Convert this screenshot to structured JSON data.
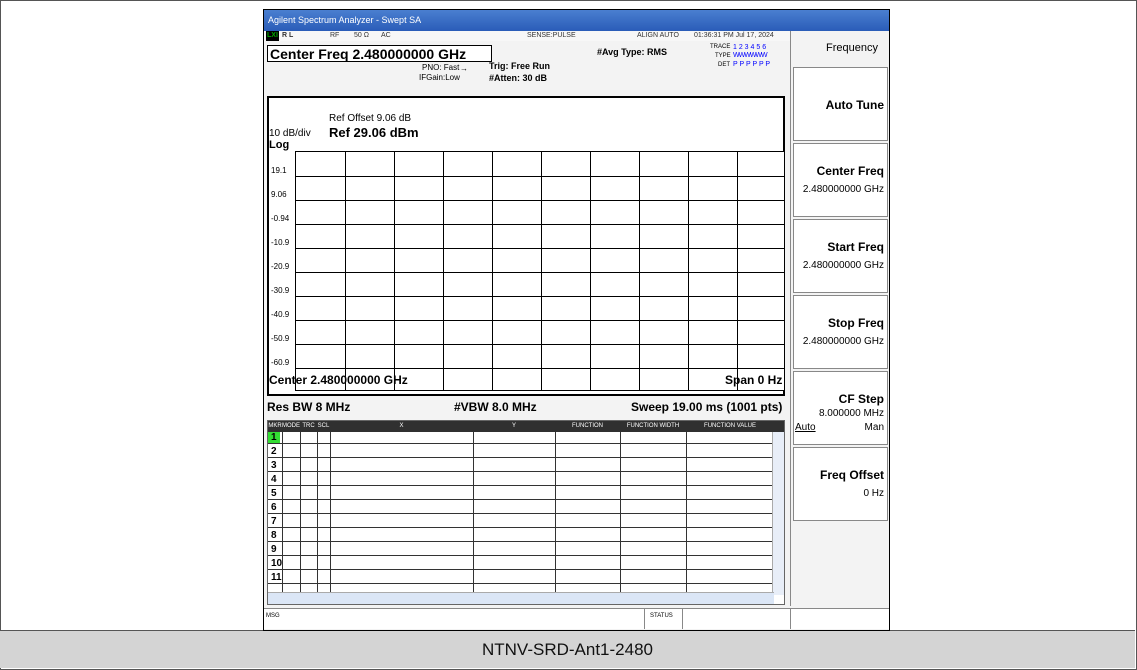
{
  "window_title": "Agilent Spectrum Analyzer - Swept SA",
  "status": {
    "rl": "R L",
    "rf": "RF",
    "impedance": "50 Ω",
    "coupling": "AC",
    "sense": "SENSE:PULSE",
    "align": "ALIGN AUTO",
    "datetime": "01:36:31 PM Jul 17, 2024",
    "avg_type": "#Avg Type: RMS",
    "trace_label": "TRACE",
    "trace_nums": "1 2 3 4 5 6",
    "type_label": "TYPE",
    "type_vals": "WWWWWW",
    "det_label": "DET",
    "det_vals": "P P P P P P"
  },
  "settings": {
    "center_freq_title": "Center Freq 2.480000000 GHz",
    "pno": "PNO: Fast",
    "ifgain": "IFGain:Low",
    "trig": "Trig: Free Run",
    "atten": "#Atten: 30 dB"
  },
  "display": {
    "ref_offset": "Ref Offset 9.06 dB",
    "scale": "10 dB/div",
    "ref_level": "Ref 29.06 dBm",
    "log": "Log",
    "y_labels": [
      "19.1",
      "9.06",
      "-0.94",
      "-10.9",
      "-20.9",
      "-30.9",
      "-40.9",
      "-50.9",
      "-60.9"
    ]
  },
  "footer": {
    "center": "Center 2.480000000 GHz",
    "span": "Span 0 Hz",
    "res_bw": "Res BW 8 MHz",
    "vbw": "#VBW 8.0 MHz",
    "sweep": "Sweep  19.00 ms (1001 pts)"
  },
  "marker_table": {
    "headers": [
      "MKR",
      "MODE",
      "TRC",
      "SCL",
      "X",
      "Y",
      "FUNCTION",
      "FUNCTION WIDTH",
      "FUNCTION VALUE"
    ],
    "rows": [
      "1",
      "2",
      "3",
      "4",
      "5",
      "6",
      "7",
      "8",
      "9",
      "10",
      "11"
    ]
  },
  "msg": {
    "msg_label": "MSG",
    "status_label": "STATUS"
  },
  "softkeys": {
    "menu_title": "Frequency",
    "auto_tune": "Auto Tune",
    "center_freq": "Center Freq",
    "center_freq_val": "2.480000000 GHz",
    "start_freq": "Start Freq",
    "start_freq_val": "2.480000000 GHz",
    "stop_freq": "Stop Freq",
    "stop_freq_val": "2.480000000 GHz",
    "cf_step": "CF Step",
    "cf_step_val": "8.000000 MHz",
    "cf_auto": "Auto",
    "cf_man": "Man",
    "freq_offset": "Freq Offset",
    "freq_offset_val": "0 Hz"
  },
  "caption": "NTNV-SRD-Ant1-2480"
}
